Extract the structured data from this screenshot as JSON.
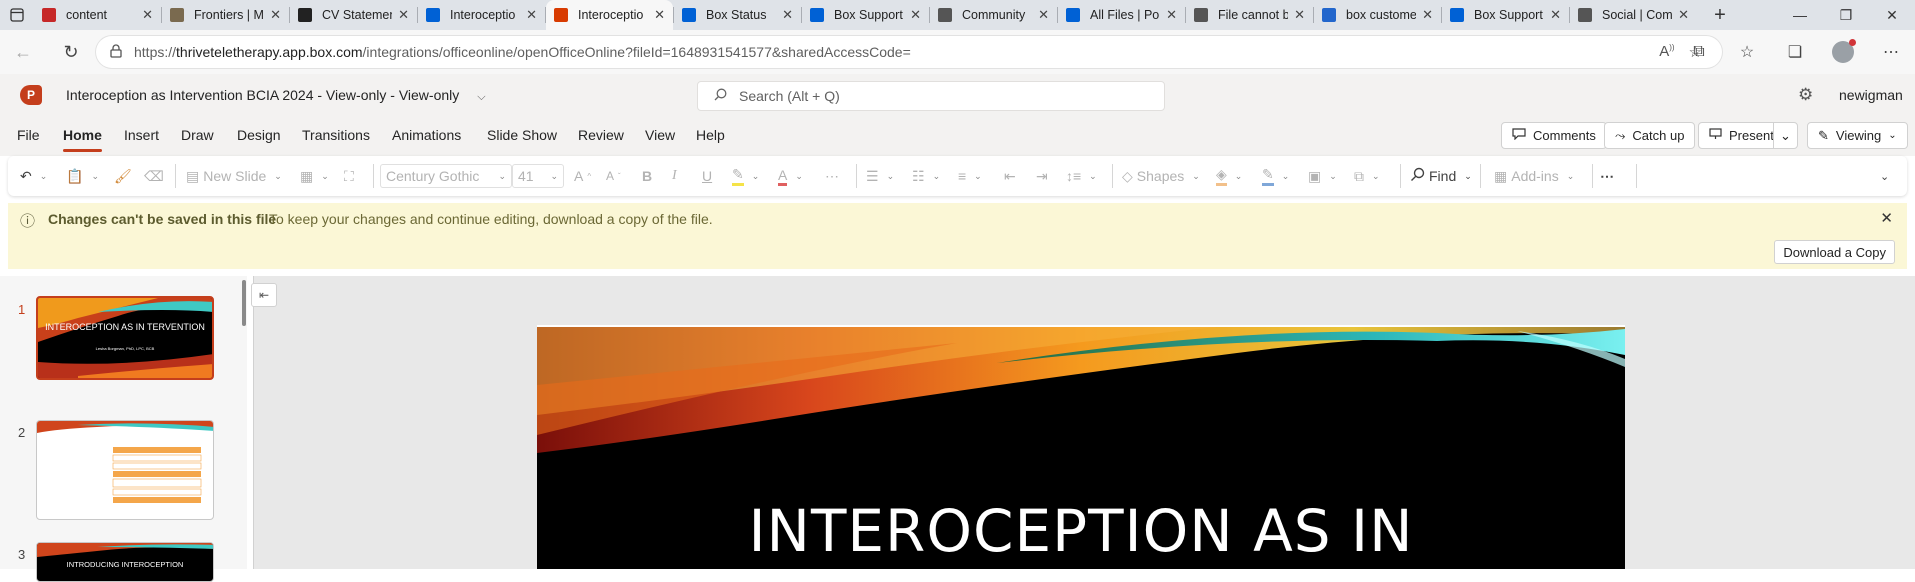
{
  "browser": {
    "tabs": [
      {
        "title": "content",
        "icon": "pdf-icon",
        "color": "#c62828",
        "active": false
      },
      {
        "title": "Frontiers | M",
        "icon": "frontiers-icon",
        "color": "#7a6a4f",
        "active": false
      },
      {
        "title": "CV Statemen",
        "icon": "openai-icon",
        "color": "#222222",
        "active": false
      },
      {
        "title": "Interoceptio",
        "icon": "box-icon",
        "color": "#0061d5",
        "active": false
      },
      {
        "title": "Interoceptio",
        "icon": "office-icon",
        "color": "#d83b01",
        "active": true
      },
      {
        "title": "Box Status",
        "icon": "box-icon",
        "color": "#0061d5",
        "active": false
      },
      {
        "title": "Box Support",
        "icon": "box-icon",
        "color": "#0061d5",
        "active": false
      },
      {
        "title": "Community",
        "icon": "globe-icon",
        "color": "#555555",
        "active": false
      },
      {
        "title": "All Files | Po",
        "icon": "box-icon",
        "color": "#0061d5",
        "active": false
      },
      {
        "title": "File cannot b",
        "icon": "globe-icon",
        "color": "#555555",
        "active": false
      },
      {
        "title": "box custome",
        "icon": "search-icon",
        "color": "#2266cc",
        "active": false
      },
      {
        "title": "Box Support",
        "icon": "box-icon",
        "color": "#0061d5",
        "active": false
      },
      {
        "title": "Social | Com",
        "icon": "globe-icon",
        "color": "#555555",
        "active": false
      }
    ],
    "url_prefix": "https://",
    "url_host": "thriveteletherapy.app.box.com",
    "url_path": "/integrations/officeonline/openOfficeOnline?fileId=1648931541577&sharedAccessCode="
  },
  "app": {
    "logo_letter": "P",
    "doc_title": "Interoception as Intervention BCIA 2024  -  View-only  -  View-only",
    "search_placeholder": "Search (Alt + Q)",
    "user_name": "newigman",
    "accent": "#c43e1c"
  },
  "menu": {
    "items": [
      "File",
      "Home",
      "Insert",
      "Draw",
      "Design",
      "Transitions",
      "Animations",
      "Slide Show",
      "Review",
      "View",
      "Help"
    ],
    "active": "Home",
    "comments": "Comments",
    "catch_up": "Catch up",
    "present": "Present",
    "viewing": "Viewing"
  },
  "ribbon": {
    "new_slide": "New Slide",
    "font_name": "Century Gothic",
    "font_size": "41",
    "shapes": "Shapes",
    "find": "Find",
    "addins": "Add-ins"
  },
  "banner": {
    "heading": "Changes can't be saved in this file",
    "message": "To keep your changes and continue editing, download a copy of the file.",
    "download": "Download a Copy",
    "bg": "#fbf7d6"
  },
  "slides": [
    {
      "num": "1",
      "title": "INTEROCEPTION AS IN TERVENTION",
      "subtitle": "Lesha Borgman, PhD, LPC, BCB"
    },
    {
      "num": "2"
    },
    {
      "num": "3",
      "title": "INTRODUCING INTEROCEPTION"
    }
  ],
  "main_slide": {
    "title": "INTEROCEPTION AS IN"
  }
}
